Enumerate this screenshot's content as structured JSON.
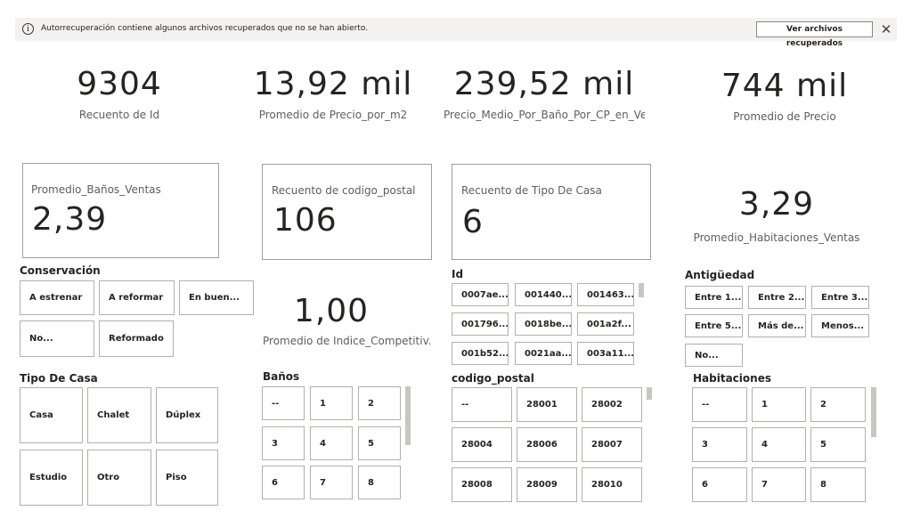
{
  "notification": {
    "icon": "info-icon",
    "message": "Autorrecuperación contiene algunos archivos recuperados que no se han abierto.",
    "button_label": "Ver archivos recuperados",
    "close_glyph": "✕"
  },
  "top_cards": [
    {
      "value": "9304",
      "label": "Recuento de Id"
    },
    {
      "value": "13,92 mil",
      "label": "Promedio de Precio_por_m2"
    },
    {
      "value": "239,52 mil",
      "label": "Precio_Medio_Por_Baño_Por_CP_en_Ve..."
    },
    {
      "value": "744 mil",
      "label": "Promedio de Precio"
    }
  ],
  "boxed_cards": [
    {
      "label": "Promedio_Baños_Ventas",
      "value": "2,39"
    },
    {
      "label": "Recuento de codigo_postal",
      "value": "106"
    },
    {
      "label": "Recuento de Tipo De Casa",
      "value": "6"
    }
  ],
  "plain_cards": [
    {
      "value": "3,29",
      "label": "Promedio_Habitaciones_Ventas"
    },
    {
      "value": "1,00",
      "label": "Promedio de Indice_Competitiv..."
    }
  ],
  "slicers": {
    "conservacion": {
      "title": "Conservación",
      "items": [
        "A estrenar",
        "A reformar",
        "En buen...",
        "No...",
        "Reformado"
      ]
    },
    "tipo_casa": {
      "title": "Tipo De Casa",
      "items": [
        "Casa",
        "Chalet",
        "Dúplex",
        "Estudio",
        "Otro",
        "Piso"
      ]
    },
    "banos": {
      "title": "Baños",
      "items": [
        "--",
        "1",
        "2",
        "3",
        "4",
        "5",
        "6",
        "7",
        "8"
      ]
    },
    "id": {
      "title": "Id",
      "items": [
        "0007ae...",
        "001440...",
        "001463...",
        "001796...",
        "0018be...",
        "001a2f...",
        "001b52...",
        "0021aa...",
        "003a11..."
      ]
    },
    "codigo_postal": {
      "title": "codigo_postal",
      "items": [
        "--",
        "28001",
        "28002",
        "28004",
        "28006",
        "28007",
        "28008",
        "28009",
        "28010"
      ]
    },
    "antiguedad": {
      "title": "Antigüedad",
      "items": [
        "Entre 1...",
        "Entre 2...",
        "Entre 3...",
        "Entre 5...",
        "Más de...",
        "Menos...",
        "No..."
      ]
    },
    "habitaciones": {
      "title": "Habitaciones",
      "items": [
        "--",
        "1",
        "2",
        "3",
        "4",
        "5",
        "6",
        "7",
        "8"
      ]
    }
  }
}
